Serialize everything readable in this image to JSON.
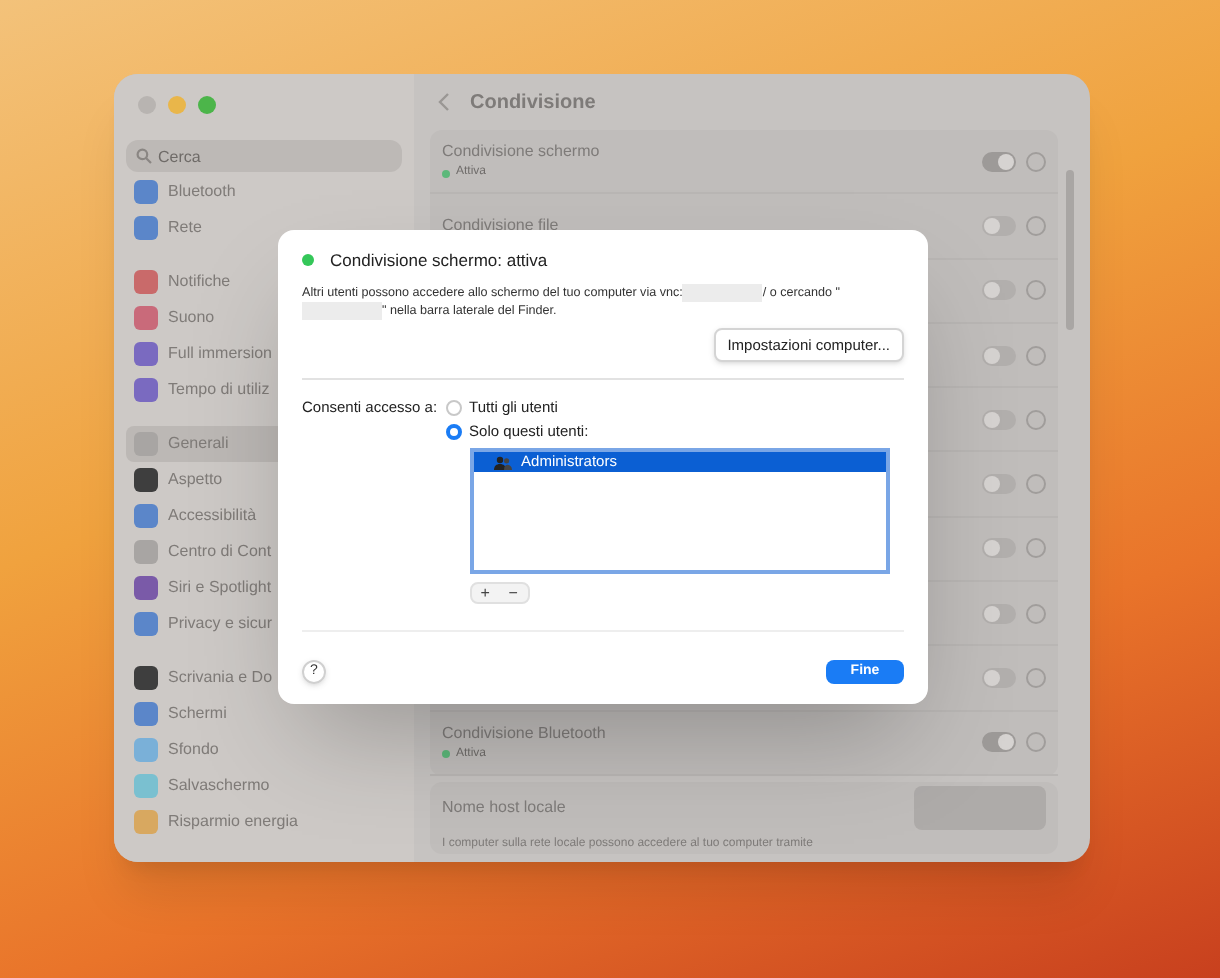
{
  "window": {
    "title": "Condivisione",
    "search": {
      "placeholder": "Cerca"
    }
  },
  "sidebar": {
    "groups": [
      [
        {
          "label": "Bluetooth",
          "color": "#5b86c9",
          "selected": false
        },
        {
          "label": "Rete",
          "color": "#5b86c9",
          "selected": false
        }
      ],
      [
        {
          "label": "Notifiche",
          "color": "#c96a6a",
          "selected": false
        },
        {
          "label": "Suono",
          "color": "#c96a7a",
          "selected": false
        },
        {
          "label": "Full immersion",
          "color": "#7a6ac0",
          "selected": false
        },
        {
          "label": "Tempo di utiliz",
          "color": "#7a6ac0",
          "selected": false
        }
      ],
      [
        {
          "label": "Generali",
          "color": "#a8a5a3",
          "selected": true
        },
        {
          "label": "Aspetto",
          "color": "#3e3e3e",
          "selected": false
        },
        {
          "label": "Accessibilità",
          "color": "#5b86c9",
          "selected": false
        },
        {
          "label": "Centro di Cont",
          "color": "#a8a5a3",
          "selected": false
        },
        {
          "label": "Siri e Spotlight",
          "color": "#7a5aa8",
          "selected": false
        },
        {
          "label": "Privacy e sicur",
          "color": "#5b86c9",
          "selected": false
        }
      ],
      [
        {
          "label": "Scrivania e Do",
          "color": "#3e3e3e",
          "selected": false
        },
        {
          "label": "Schermi",
          "color": "#5b86c9",
          "selected": false
        },
        {
          "label": "Sfondo",
          "color": "#7ab0d8",
          "selected": false
        },
        {
          "label": "Salvaschermo",
          "color": "#7ac0d0",
          "selected": false
        },
        {
          "label": "Risparmio energia",
          "color": "#d8a860",
          "selected": false
        }
      ]
    ]
  },
  "services": [
    {
      "label": "Condivisione schermo",
      "status": "Attiva",
      "on": true
    },
    {
      "label": "Condivisione file",
      "on": false
    },
    {
      "on": false
    },
    {
      "on": false
    },
    {
      "on": false
    },
    {
      "on": false
    },
    {
      "on": false
    },
    {
      "on": false
    },
    {
      "on": false
    },
    {
      "label": "Condivisione Bluetooth",
      "status": "Attiva",
      "on": true
    }
  ],
  "hostname": {
    "label": "Nome host locale",
    "note": "I computer sulla rete locale possono accedere al tuo computer tramite"
  },
  "sheet": {
    "title": "Condivisione schermo: attiva",
    "status_on": true,
    "description": [
      {
        "kind": "text",
        "text": "Altri utenti possono accedere allo schermo del tuo computer via vnc:"
      },
      {
        "kind": "redacted"
      },
      {
        "kind": "text",
        "text": "/ o cercando \""
      },
      {
        "kind": "redacted"
      },
      {
        "kind": "text",
        "text": "\" nella barra laterale del Finder."
      }
    ],
    "settings_button": "Impostazioni computer...",
    "access_label": "Consenti accesso a:",
    "access_options": [
      {
        "label": "Tutti gli utenti",
        "selected": false
      },
      {
        "label": "Solo questi utenti:",
        "selected": true
      }
    ],
    "users": [
      {
        "label": "Administrators",
        "selected": true
      }
    ],
    "add_button": "+",
    "remove_button": "−",
    "help_button": "?",
    "done_button": "Fine"
  }
}
